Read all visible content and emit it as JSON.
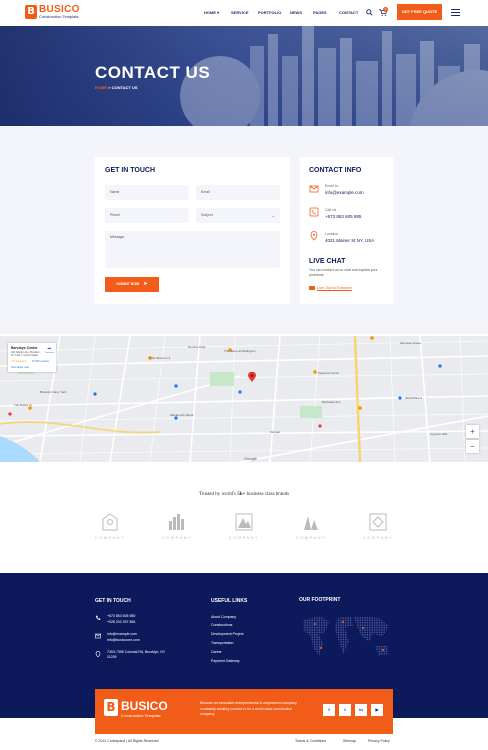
{
  "brand": {
    "logo_letter": "B",
    "name": "BUSICO",
    "tagline": "Construction Template"
  },
  "nav": {
    "items": [
      "HOME ▾",
      "SERVICE",
      "PORTFOLIO",
      "NEWS",
      "PAGES",
      "CONTACT"
    ],
    "cart_count": "0",
    "quote_label": "GET FREE QUOTE"
  },
  "hero": {
    "title": "CONTACT US",
    "crumb_home": "HOME",
    "crumb_sep": ">",
    "crumb_current": "CONTACT US"
  },
  "form": {
    "title": "GET IN TOUCH",
    "name_placeholder": "Name",
    "email_placeholder": "Email",
    "phone_placeholder": "Phone",
    "subject_placeholder": "Subject",
    "message_placeholder": "Message",
    "submit_label": "SUBMIT NOW"
  },
  "contact_info": {
    "title": "CONTACT INFO",
    "email_label": "Email to:",
    "email": "info@example.com",
    "call_label": "Call Us",
    "phone": "+673 853 605 985",
    "location_label": "Location",
    "address": "4021 Mainer St NY, USA",
    "live_title": "LIVE CHAT",
    "live_text": "You can contact us on chat and explain your problems.",
    "live_link": "Live Chat to Executive"
  },
  "map": {
    "card_title": "Barclays Center",
    "card_address": "620 Atlantic Ave, Brooklyn, NY 11217, United States",
    "card_rating": "4.5 ★★★★★",
    "card_reviews": "97,832 reviews",
    "card_link": "View larger map",
    "directions": "Directions",
    "zoom_in": "+",
    "zoom_out": "−",
    "google": "Google",
    "labels": [
      "The Museum 3",
      "Domino Park",
      "The Salve at Wellington",
      "Peacock Farms",
      "Mountain Dates",
      "Manila-Lilly Mural",
      "NEOPRILLS",
      "Bushwick Ave",
      "The Bucks Yo",
      "Brooklyn Navy Yard",
      "Morgan",
      "Cypress Hills"
    ]
  },
  "brands": {
    "trusted_prefix": "Trusted by world's ",
    "trusted_count": "5k+",
    "trusted_suffix": " business class brands",
    "names": [
      "COMPANY",
      "COMPANY",
      "COMPANY",
      "COMPANY",
      "COMPANY"
    ]
  },
  "footer": {
    "touch_title": "GET IN TOUCH",
    "phone1": "+673 853 605 985",
    "phone2": "+928 202 397 896",
    "email1": "info@example.com",
    "email2": "info@busicoone.com",
    "address": "7303-7398 Colonial Rd, Brooklyn, NY 11209",
    "links_title": "USEFUL LINKS",
    "links": [
      "About Company",
      "Constructions",
      "Development Project",
      "Transportation",
      "Career",
      "Payment Gateway"
    ],
    "footprint_title": "OUR FOOTPRINT",
    "about": "Become an innovative entrepreneurial & empowered company constantly creating sources to be a world class construction company.",
    "social": [
      "f",
      "t",
      "in",
      "▶"
    ],
    "copyright": "© 2021 Codexpand  |  All Rights Reserved",
    "bottom_links": [
      "Teams & Conditions",
      "Sitemap",
      "Privacy Policy"
    ]
  },
  "colors": {
    "accent": "#f25c19",
    "navy": "#0c1a5c",
    "light_bg": "#f3f5fa"
  }
}
